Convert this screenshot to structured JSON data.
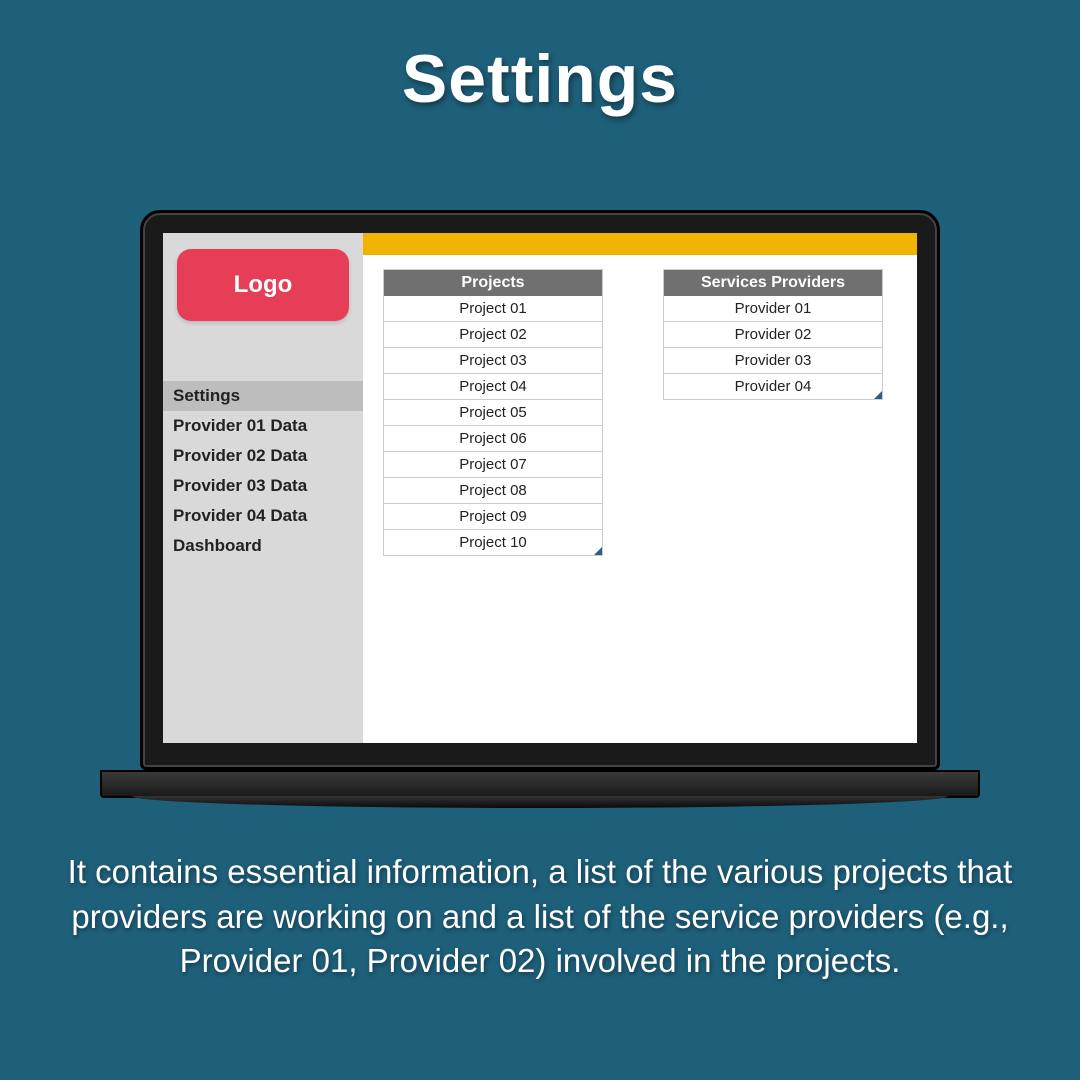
{
  "page_title": "Settings",
  "logo_text": "Logo",
  "sidebar": {
    "items": [
      {
        "label": "Settings",
        "active": true
      },
      {
        "label": "Provider 01 Data",
        "active": false
      },
      {
        "label": "Provider 02 Data",
        "active": false
      },
      {
        "label": "Provider 03 Data",
        "active": false
      },
      {
        "label": "Provider 04 Data",
        "active": false
      },
      {
        "label": "Dashboard",
        "active": false
      }
    ]
  },
  "projects": {
    "header": "Projects",
    "rows": [
      "Project 01",
      "Project 02",
      "Project 03",
      "Project 04",
      "Project 05",
      "Project 06",
      "Project 07",
      "Project 08",
      "Project 09",
      "Project 10"
    ]
  },
  "providers": {
    "header": "Services Providers",
    "rows": [
      "Provider 01",
      "Provider 02",
      "Provider 03",
      "Provider 04"
    ]
  },
  "description": "It contains essential information, a list of the various projects that providers are working on and a list of the service providers (e.g., Provider 01, Provider 02) involved in the projects.",
  "colors": {
    "background": "#1e5f7a",
    "accent_yellow": "#f0b400",
    "logo_red": "#e63e57",
    "table_header": "#707070",
    "sidebar_bg": "#d9d9d9",
    "sidebar_active": "#bdbdbd"
  }
}
